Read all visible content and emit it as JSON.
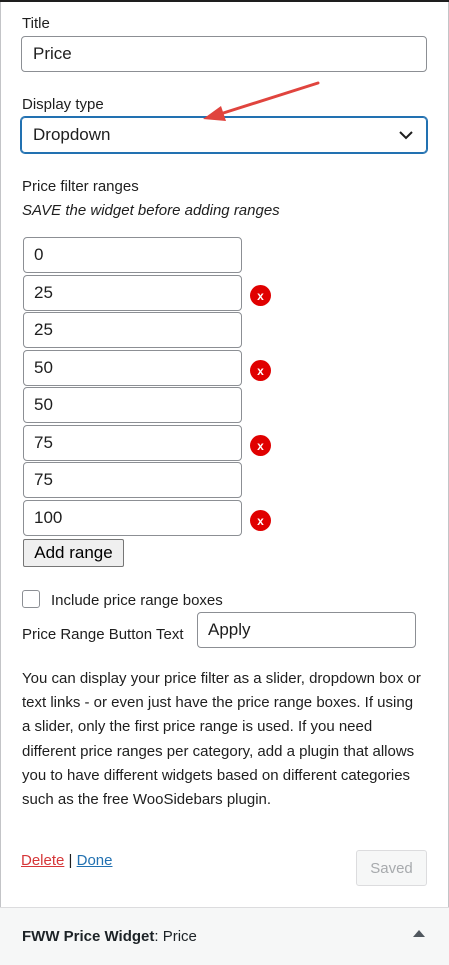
{
  "fields": {
    "title_label": "Title",
    "title_value": "Price",
    "display_type_label": "Display type",
    "display_type_value": "Dropdown",
    "ranges_label": "Price filter ranges",
    "ranges_note": "SAVE the widget before adding ranges"
  },
  "ranges": [
    {
      "value": "0",
      "removable": false
    },
    {
      "value": "25",
      "removable": true
    },
    {
      "value": "25",
      "removable": false
    },
    {
      "value": "50",
      "removable": true
    },
    {
      "value": "50",
      "removable": false
    },
    {
      "value": "75",
      "removable": true
    },
    {
      "value": "75",
      "removable": false
    },
    {
      "value": "100",
      "removable": true
    }
  ],
  "remove_label": "x",
  "add_range_label": "Add range",
  "include_boxes": {
    "label": "Include price range boxes",
    "checked": false
  },
  "button_text": {
    "label": "Price Range Button Text",
    "value": "Apply"
  },
  "help_text": "You can display your price filter as a slider, dropdown box or text links - or even just have the price range boxes. If using a slider, only the first price range is used. If you need different price ranges per category, add a plugin that allows you to have different widgets based on different categories such as the free WooSidebars plugin.",
  "actions": {
    "delete": "Delete",
    "separator": "|",
    "done": "Done",
    "saved": "Saved"
  },
  "footer": {
    "widget_name": "FWW Price Widget",
    "separator": ": ",
    "instance_title": "Price"
  },
  "colors": {
    "accent": "#2271b1",
    "danger": "#d63638",
    "remove_badge": "#e00000",
    "arrow": "#e0443e"
  },
  "icons": {
    "dropdown": "chevron-down-icon",
    "collapse": "triangle-up-icon",
    "annotation": "red-arrow"
  }
}
